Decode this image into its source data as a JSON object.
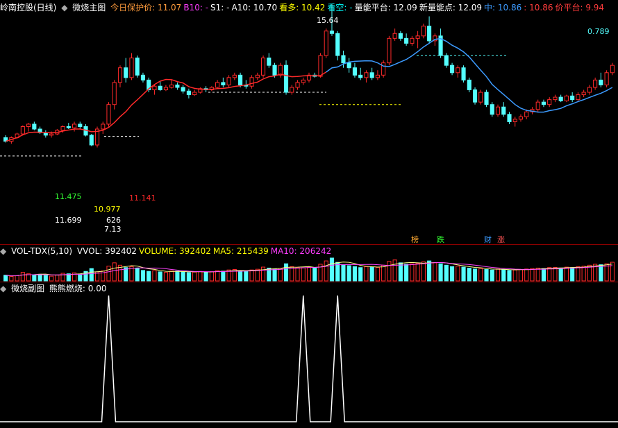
{
  "main_header": {
    "title": "岭南控股(日线)",
    "indicator": "微烧主图",
    "items": [
      {
        "text": "今日保护价: 11.07",
        "color": "#ff9b3c"
      },
      {
        "text": "B10: -",
        "color": "#ff3cff"
      },
      {
        "text": "S1: -",
        "color": "#ffffff"
      },
      {
        "text": "A10: 10.70",
        "color": "#ffffff"
      },
      {
        "text": "看多: 10.42",
        "color": "#ffff00"
      },
      {
        "text": "看空: -",
        "color": "#00ffff"
      },
      {
        "text": "量能平台: 12.09",
        "color": "#ffffff"
      },
      {
        "text": "新量能点: 12.09",
        "color": "#ffffff"
      },
      {
        "text": "中: 10.86",
        "color": "#3c9bff"
      },
      {
        "text": ": 10.86",
        "color": "#ff3c3c"
      },
      {
        "text": "价平台: 9.94",
        "color": "#ff3c3c"
      }
    ]
  },
  "vol_header": {
    "title": "VOL-TDX(5,10)",
    "items": [
      {
        "text": "VVOL: 392402",
        "color": "#ffffff"
      },
      {
        "text": "VOLUME: 392402",
        "color": "#ffff00"
      },
      {
        "text": "MA5: 215439",
        "color": "#ffff00"
      },
      {
        "text": "MA10: 206242",
        "color": "#ff3cff"
      }
    ]
  },
  "sub_header": {
    "title": "微烧副图",
    "items": [
      {
        "text": "熊熊燃烧: 0.00",
        "color": "#ffffff"
      }
    ]
  },
  "price_labels": {
    "p1": "15.64",
    "p2": "0.789",
    "p3": "11.475",
    "p4": "11.141",
    "p5": "10.977",
    "p6": "11.699",
    "p7": "626",
    "p8": "7.13"
  },
  "tags": [
    {
      "text": "榜",
      "color": "#ffaa33"
    },
    {
      "text": "跌",
      "color": "#33ff33"
    },
    {
      "text": "财",
      "color": "#3c9bff"
    },
    {
      "text": "涨",
      "color": "#ff5555"
    }
  ],
  "colors": {
    "up": "#ff2a2a",
    "down": "#54ffff",
    "ma": "#ff2a2a",
    "ma2": "#3c9bff",
    "vol_ma5": "#ffff88",
    "vol_ma10": "#ff44ff",
    "burn": "#ffffff"
  },
  "chart_data": {
    "type": "candlestick",
    "price_range": [
      6.8,
      16.0
    ],
    "candles": [
      [
        10.95,
        11.05,
        10.75,
        10.8
      ],
      [
        10.8,
        11.0,
        10.7,
        10.95
      ],
      [
        10.95,
        11.15,
        10.9,
        11.1
      ],
      [
        11.1,
        11.45,
        11.05,
        11.4
      ],
      [
        11.4,
        11.55,
        11.2,
        11.5
      ],
      [
        11.5,
        11.6,
        11.25,
        11.3
      ],
      [
        11.3,
        11.4,
        11.1,
        11.15
      ],
      [
        11.15,
        11.25,
        10.95,
        11.05
      ],
      [
        11.05,
        11.2,
        10.95,
        11.1
      ],
      [
        11.1,
        11.3,
        11.05,
        11.25
      ],
      [
        11.25,
        11.45,
        11.15,
        11.4
      ],
      [
        11.4,
        11.55,
        11.3,
        11.35
      ],
      [
        11.35,
        11.6,
        11.2,
        11.5
      ],
      [
        11.5,
        11.6,
        11.3,
        11.4
      ],
      [
        11.4,
        11.5,
        11.0,
        11.05
      ],
      [
        11.05,
        11.1,
        10.6,
        10.65
      ],
      [
        10.65,
        11.4,
        10.55,
        11.3
      ],
      [
        11.3,
        11.6,
        11.1,
        11.5
      ],
      [
        11.5,
        12.4,
        11.4,
        12.3
      ],
      [
        12.3,
        13.3,
        12.1,
        13.2
      ],
      [
        13.2,
        13.9,
        13.0,
        13.8
      ],
      [
        13.8,
        14.2,
        13.2,
        13.4
      ],
      [
        13.4,
        14.4,
        13.3,
        14.2
      ],
      [
        14.2,
        14.3,
        13.4,
        13.5
      ],
      [
        13.5,
        13.6,
        13.2,
        13.3
      ],
      [
        13.3,
        13.4,
        12.8,
        12.9
      ],
      [
        12.9,
        13.1,
        12.7,
        13.05
      ],
      [
        13.05,
        13.25,
        12.85,
        12.9
      ],
      [
        12.9,
        13.1,
        12.85,
        13.0
      ],
      [
        13.0,
        13.3,
        12.95,
        13.1
      ],
      [
        13.1,
        13.2,
        12.9,
        13.0
      ],
      [
        13.0,
        13.1,
        12.75,
        12.85
      ],
      [
        12.85,
        12.95,
        12.55,
        12.7
      ],
      [
        12.7,
        12.9,
        12.65,
        12.8
      ],
      [
        12.8,
        13.0,
        12.75,
        12.95
      ],
      [
        12.95,
        13.05,
        12.8,
        12.9
      ],
      [
        12.9,
        13.05,
        12.85,
        13.0
      ],
      [
        13.0,
        13.3,
        12.95,
        13.2
      ],
      [
        13.2,
        13.4,
        13.0,
        13.1
      ],
      [
        13.1,
        13.5,
        13.0,
        13.4
      ],
      [
        13.4,
        13.6,
        13.3,
        13.5
      ],
      [
        13.5,
        13.6,
        13.0,
        13.1
      ],
      [
        13.1,
        13.3,
        12.95,
        13.05
      ],
      [
        13.05,
        13.5,
        12.95,
        13.4
      ],
      [
        13.4,
        13.6,
        13.3,
        13.5
      ],
      [
        13.5,
        14.3,
        13.4,
        14.2
      ],
      [
        14.2,
        14.4,
        13.8,
        13.9
      ],
      [
        13.9,
        14.0,
        13.4,
        13.5
      ],
      [
        13.5,
        14.0,
        13.4,
        13.9
      ],
      [
        13.9,
        14.1,
        12.7,
        12.8
      ],
      [
        12.8,
        13.1,
        12.7,
        13.0
      ],
      [
        13.0,
        13.3,
        12.9,
        13.2
      ],
      [
        13.2,
        13.4,
        13.1,
        13.3
      ],
      [
        13.3,
        13.6,
        13.2,
        13.5
      ],
      [
        13.5,
        13.6,
        13.4,
        13.45
      ],
      [
        13.45,
        14.4,
        13.4,
        14.3
      ],
      [
        14.3,
        15.4,
        14.2,
        15.3
      ],
      [
        15.3,
        16.4,
        15.1,
        15.2
      ],
      [
        15.2,
        15.3,
        14.1,
        14.3
      ],
      [
        14.3,
        14.5,
        13.8,
        14.0
      ],
      [
        14.0,
        14.2,
        13.6,
        13.8
      ],
      [
        13.8,
        14.0,
        13.4,
        13.5
      ],
      [
        13.5,
        13.8,
        13.3,
        13.4
      ],
      [
        13.4,
        13.7,
        13.2,
        13.6
      ],
      [
        13.6,
        13.8,
        13.3,
        13.4
      ],
      [
        13.4,
        13.7,
        13.3,
        13.5
      ],
      [
        13.5,
        14.1,
        13.4,
        14.0
      ],
      [
        14.0,
        15.1,
        13.9,
        15.0
      ],
      [
        15.0,
        15.4,
        14.9,
        15.2
      ],
      [
        15.2,
        15.3,
        14.9,
        15.0
      ],
      [
        15.0,
        15.2,
        14.7,
        14.8
      ],
      [
        14.8,
        15.1,
        14.7,
        15.0
      ],
      [
        15.0,
        15.3,
        14.6,
        15.1
      ],
      [
        15.1,
        15.6,
        15.0,
        15.5
      ],
      [
        15.5,
        15.9,
        14.8,
        14.9
      ],
      [
        14.9,
        15.2,
        14.7,
        15.1
      ],
      [
        15.1,
        15.4,
        14.2,
        14.3
      ],
      [
        14.3,
        14.4,
        13.8,
        13.9
      ],
      [
        13.9,
        14.0,
        13.5,
        13.6
      ],
      [
        13.6,
        13.9,
        13.4,
        13.8
      ],
      [
        13.8,
        13.9,
        13.2,
        13.3
      ],
      [
        13.3,
        13.4,
        12.8,
        12.9
      ],
      [
        12.9,
        13.0,
        12.3,
        12.4
      ],
      [
        12.4,
        12.9,
        12.3,
        12.8
      ],
      [
        12.8,
        12.9,
        12.2,
        12.3
      ],
      [
        12.3,
        12.4,
        11.8,
        11.9
      ],
      [
        11.9,
        12.3,
        11.8,
        12.2
      ],
      [
        12.2,
        12.4,
        11.8,
        11.9
      ],
      [
        11.9,
        12.0,
        11.5,
        11.6
      ],
      [
        11.6,
        11.8,
        11.4,
        11.7
      ],
      [
        11.7,
        11.9,
        11.6,
        11.8
      ],
      [
        11.8,
        12.1,
        11.7,
        12.0
      ],
      [
        12.0,
        12.2,
        11.9,
        12.1
      ],
      [
        12.1,
        12.5,
        12.0,
        12.4
      ],
      [
        12.4,
        12.5,
        12.2,
        12.3
      ],
      [
        12.3,
        12.6,
        12.2,
        12.5
      ],
      [
        12.5,
        12.7,
        12.4,
        12.6
      ],
      [
        12.6,
        12.7,
        12.4,
        12.45
      ],
      [
        12.45,
        12.7,
        12.4,
        12.65
      ],
      [
        12.65,
        12.8,
        12.4,
        12.5
      ],
      [
        12.5,
        12.8,
        12.45,
        12.7
      ],
      [
        12.7,
        12.9,
        12.6,
        12.8
      ],
      [
        12.8,
        13.1,
        12.7,
        13.0
      ],
      [
        13.0,
        13.4,
        12.9,
        13.3
      ],
      [
        13.3,
        13.6,
        13.0,
        13.1
      ],
      [
        13.1,
        13.7,
        13.0,
        13.6
      ],
      [
        13.6,
        14.0,
        13.5,
        13.9
      ]
    ],
    "volume": [
      120,
      95,
      110,
      180,
      150,
      130,
      140,
      115,
      100,
      125,
      160,
      150,
      170,
      145,
      200,
      260,
      190,
      210,
      310,
      380,
      330,
      280,
      300,
      270,
      220,
      200,
      215,
      190,
      180,
      210,
      205,
      195,
      175,
      185,
      200,
      190,
      195,
      215,
      205,
      230,
      240,
      210,
      200,
      230,
      245,
      290,
      270,
      250,
      260,
      360,
      300,
      280,
      275,
      290,
      270,
      350,
      420,
      480,
      390,
      340,
      320,
      300,
      280,
      300,
      290,
      285,
      330,
      410,
      440,
      380,
      350,
      360,
      370,
      400,
      420,
      380,
      360,
      330,
      300,
      310,
      290,
      270,
      250,
      260,
      240,
      230,
      250,
      240,
      220,
      230,
      240,
      250,
      260,
      270,
      260,
      280,
      285,
      270,
      290,
      280,
      300,
      310,
      330,
      350,
      340,
      360,
      392
    ],
    "burn_peaks": [
      18,
      52,
      58
    ]
  }
}
